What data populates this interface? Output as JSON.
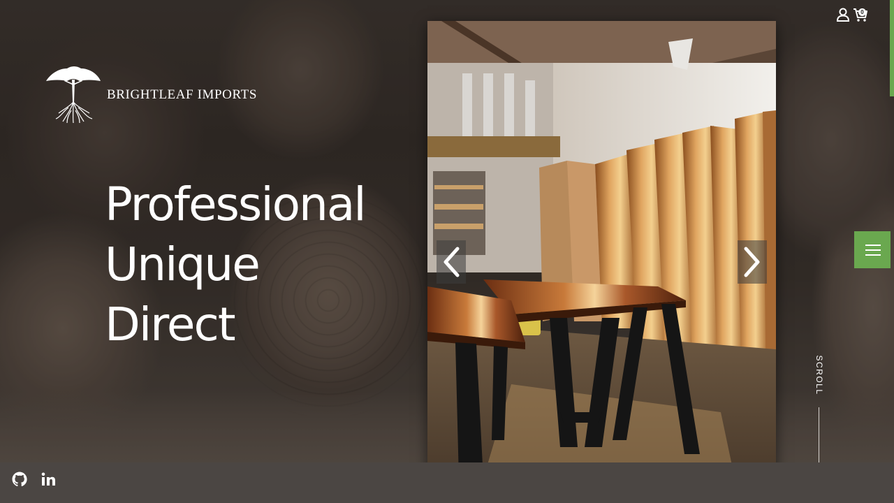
{
  "brand": {
    "name": "BRIGHTLEAF IMPORTS",
    "logo_icon": "tree-logo-icon"
  },
  "hero": {
    "lines": [
      "Professional",
      "Unique",
      "Direct"
    ]
  },
  "header": {
    "account_icon": "user-icon",
    "cart_icon": "cart-icon",
    "cart_count": "0"
  },
  "slideshow": {
    "prev_icon": "chevron-left-icon",
    "next_icon": "chevron-right-icon",
    "image_subject": "river-tables-and-wood-slabs-photo"
  },
  "side": {
    "menu_icon": "hamburger-icon",
    "scroll_label": "SCROLL"
  },
  "footer": {
    "social": [
      {
        "name": "github-icon"
      },
      {
        "name": "linkedin-icon"
      }
    ]
  },
  "colors": {
    "accent": "#6aa84f",
    "footer": "#4b4643",
    "text": "#ffffff"
  }
}
